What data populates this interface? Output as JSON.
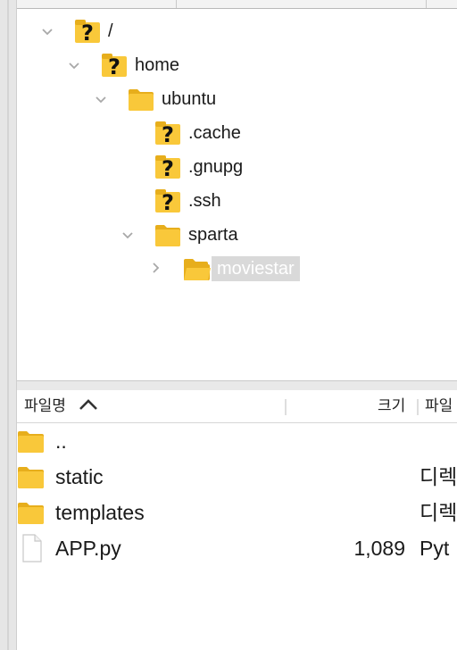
{
  "tree": {
    "nodes": [
      {
        "label": "/",
        "icon": "unknown-folder-icon",
        "expanded": true
      },
      {
        "label": "home",
        "icon": "unknown-folder-icon",
        "expanded": true
      },
      {
        "label": "ubuntu",
        "icon": "folder-icon",
        "expanded": true
      },
      {
        "label": ".cache",
        "icon": "unknown-folder-icon"
      },
      {
        "label": ".gnupg",
        "icon": "unknown-folder-icon"
      },
      {
        "label": ".ssh",
        "icon": "unknown-folder-icon"
      },
      {
        "label": "sparta",
        "icon": "folder-icon",
        "expanded": true
      },
      {
        "label": "moviestar",
        "icon": "open-folder-icon",
        "expanded": false,
        "selected": true
      }
    ]
  },
  "file_list": {
    "columns": {
      "name": "파일명",
      "size": "크기",
      "type": "파일"
    },
    "sort_indicator": "ascending",
    "rows": [
      {
        "name": "..",
        "size": "",
        "type": "",
        "icon": "folder-icon"
      },
      {
        "name": "static",
        "size": "",
        "type": "디렉",
        "icon": "folder-icon"
      },
      {
        "name": "templates",
        "size": "",
        "type": "디렉",
        "icon": "folder-icon"
      },
      {
        "name": "APP.py",
        "size": "1,089",
        "type": "Pyt",
        "icon": "file-icon"
      }
    ]
  },
  "colors": {
    "folder": "#f9c83a",
    "folder_dark": "#e7ae1c",
    "selection": "#d9d9d9",
    "chevron": "#a8a8a8"
  }
}
